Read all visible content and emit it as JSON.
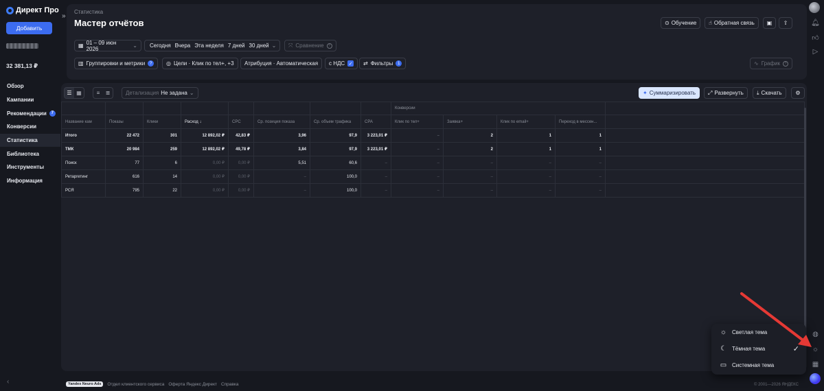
{
  "sidebar": {
    "logo": "Директ Про",
    "add_button": "Добавить",
    "balance": "32 381,13 ₽",
    "nav": [
      {
        "label": "Обзор",
        "active": false,
        "badge": ""
      },
      {
        "label": "Кампании",
        "active": false,
        "badge": ""
      },
      {
        "label": "Рекомендации",
        "active": false,
        "badge": "7"
      },
      {
        "label": "Конверсии",
        "active": false,
        "badge": ""
      },
      {
        "label": "Статистика",
        "active": true,
        "badge": ""
      },
      {
        "label": "Библиотека",
        "active": false,
        "badge": ""
      },
      {
        "label": "Инструменты",
        "active": false,
        "badge": ""
      },
      {
        "label": "Информация",
        "active": false,
        "badge": ""
      }
    ],
    "collapse_icon": "chevron-left-icon"
  },
  "header": {
    "breadcrumb": "Статистика",
    "title": "Мастер отчётов",
    "learning_button": "Обучение",
    "feedback_button": "Обратная связь"
  },
  "filters": {
    "date_range": "01 – 09 июн 2026",
    "periods": [
      "Сегодня",
      "Вчера",
      "Эта неделя",
      "7 дней",
      "30 дней"
    ],
    "compare": "Сравнение",
    "groupings": "Группировки и метрики",
    "goals": "Цели · Клик по тел+, +3",
    "attribution": "Атрибуция · Автоматическая",
    "vat": "с НДС",
    "filters_label": "Фильтры",
    "filters_badge": "1",
    "chart_button": "График"
  },
  "toolbar": {
    "detail_label": "Детализация",
    "detail_value": "Не задана",
    "summarize": "Суммаризировать",
    "expand": "Развернуть",
    "download": "Скачать"
  },
  "table": {
    "group_header": "Конверсии",
    "columns": [
      "Название кам",
      "Показы",
      "Клики",
      "Расход ↓",
      "CPC",
      "Ср. позиция показа",
      "Ср. объем трафика",
      "CPA",
      "Клик по тел+",
      "Заявка+",
      "Клик по email+",
      "Переход в мессен..."
    ],
    "rows": [
      [
        "Итого",
        "22 472",
        "301",
        "12 892,02 ₽",
        "42,83 ₽",
        "3,96",
        "97,9",
        "3 223,01 ₽",
        "–",
        "2",
        "1",
        "1"
      ],
      [
        "ТМК",
        "20 984",
        "259",
        "12 892,02 ₽",
        "49,78 ₽",
        "3,84",
        "97,9",
        "3 223,01 ₽",
        "–",
        "2",
        "1",
        "1"
      ],
      [
        "Поиск",
        "77",
        "6",
        "0,00 ₽",
        "0,00 ₽",
        "5,51",
        "60,6",
        "–",
        "–",
        "–",
        "–",
        "–"
      ],
      [
        "Ретаргетинг",
        "616",
        "14",
        "0,00 ₽",
        "0,00 ₽",
        "–",
        "100,0",
        "–",
        "–",
        "–",
        "–",
        "–"
      ],
      [
        "РСЯ",
        "795",
        "22",
        "0,00 ₽",
        "0,00 ₽",
        "–",
        "100,0",
        "–",
        "–",
        "–",
        "–",
        "–"
      ]
    ]
  },
  "footer": {
    "badge": "Yandex Neuro Ads",
    "links": [
      "Отдел клиентского сервиса",
      "Оферта Яндекс Директ",
      "Справка"
    ],
    "copyright": "© 2001—2026 ЯНДЕКС"
  },
  "theme_menu": {
    "items": [
      {
        "label": "Светлая тема",
        "icon": "sun-icon",
        "checked": false
      },
      {
        "label": "Тёмная тема",
        "icon": "moon-icon",
        "checked": true
      },
      {
        "label": "Системная тема",
        "icon": "monitor-icon",
        "checked": false
      }
    ]
  },
  "colors": {
    "accent": "#3c6cf0",
    "background": "#16181f",
    "panel": "#1e2029",
    "arrow": "#e53935"
  }
}
